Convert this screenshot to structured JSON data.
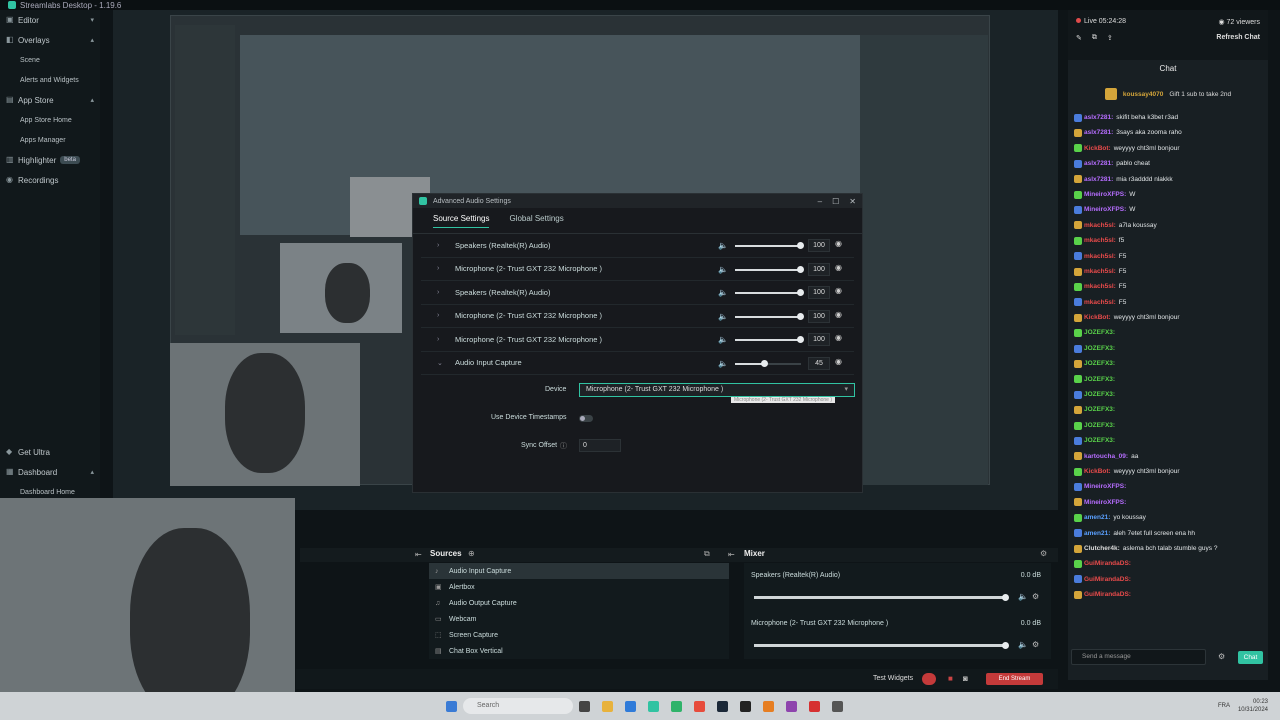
{
  "app": {
    "title": "Streamlabs Desktop - 1.19.6"
  },
  "sidebar": {
    "items": [
      {
        "label": "Editor",
        "icon": "editor-icon"
      },
      {
        "label": "Overlays",
        "icon": "overlays-icon"
      },
      {
        "label": "Scene",
        "icon": ""
      },
      {
        "label": "Alerts and Widgets",
        "icon": ""
      },
      {
        "label": "App Store",
        "icon": "app-store-icon"
      },
      {
        "label": "App Store Home",
        "icon": ""
      },
      {
        "label": "Apps Manager",
        "icon": ""
      },
      {
        "label": "Highlighter",
        "icon": "highlighter-icon",
        "badge": "beta"
      },
      {
        "label": "Recordings",
        "icon": "recordings-icon"
      }
    ],
    "bottom": {
      "get_ultra": "Get Ultra",
      "dashboard": "Dashboard",
      "dashboard_home": "Dashboard Home"
    }
  },
  "dialog": {
    "title": "Advanced Audio Settings",
    "tabs": [
      "Source Settings",
      "Global Settings"
    ],
    "rows": [
      {
        "name": "Speakers (Realtek(R) Audio)",
        "value": "100",
        "level": 1.0
      },
      {
        "name": "Microphone (2- Trust GXT 232 Microphone )",
        "value": "100",
        "level": 1.0
      },
      {
        "name": "Speakers (Realtek(R) Audio)",
        "value": "100",
        "level": 1.0
      },
      {
        "name": "Microphone (2- Trust GXT 232 Microphone )",
        "value": "100",
        "level": 1.0
      },
      {
        "name": "Microphone (2- Trust GXT 232 Microphone )",
        "value": "100",
        "level": 1.0
      },
      {
        "name": "Audio Input Capture",
        "value": "45",
        "level": 0.45
      }
    ],
    "device_label": "Device",
    "device_value": "Microphone (2- Trust GXT 232 Microphone )",
    "device_tooltip": "Microphone (2- Trust GXT 232 Microphone )",
    "timestamps_label": "Use Device Timestamps",
    "sync_label": "Sync Offset",
    "sync_value": "0"
  },
  "sources": {
    "title": "Sources",
    "items": [
      {
        "label": "Audio Input Capture",
        "icon": "audio-input-icon"
      },
      {
        "label": "Alertbox",
        "icon": "alertbox-icon"
      },
      {
        "label": "Audio Output Capture",
        "icon": "audio-output-icon"
      },
      {
        "label": "Webcam",
        "icon": "webcam-icon"
      },
      {
        "label": "Screen Capture",
        "icon": "screen-capture-icon"
      },
      {
        "label": "Chat Box Vertical",
        "icon": "chat-box-icon"
      }
    ]
  },
  "mixer": {
    "title": "Mixer",
    "channels": [
      {
        "name": "Speakers (Realtek(R) Audio)",
        "db": "0.0 dB",
        "level": 1.0
      },
      {
        "name": "Microphone (2- Trust GXT 232 Microphone )",
        "db": "0.0 dB",
        "level": 1.0
      }
    ]
  },
  "bottom_bar": {
    "test_widgets": "Test Widgets",
    "end_stream": "End Stream"
  },
  "chat": {
    "live_time": "Live 05:24:28",
    "viewers": "72 viewers",
    "refresh": "Refresh Chat",
    "title": "Chat",
    "gift_user": "koussay4070",
    "gift_text": "Gift 1 sub to take 2nd",
    "messages": [
      {
        "user": "aslx7281:",
        "text": "skifit beha k3bet r3ad",
        "color": "#b66dff"
      },
      {
        "user": "aslx7281:",
        "text": "3says aka zooma raho",
        "color": "#b66dff"
      },
      {
        "user": "KickBot:",
        "text": "weyyyy cht3ml bonjour",
        "color": "#e94b4b"
      },
      {
        "user": "aslx7281:",
        "text": "pablo cheat",
        "color": "#b66dff"
      },
      {
        "user": "aslx7281:",
        "text": "mia r3adddd nlakkk",
        "color": "#b66dff"
      },
      {
        "user": "MineiroXFPS:",
        "text": "W",
        "color": "#b66dff"
      },
      {
        "user": "MineiroXFPS:",
        "text": "W",
        "color": "#b66dff"
      },
      {
        "user": "mkach5sl:",
        "text": "a7la koussay",
        "color": "#e94b4b"
      },
      {
        "user": "mkach5sl:",
        "text": "f5",
        "color": "#e94b4b"
      },
      {
        "user": "mkach5sl:",
        "text": "F5",
        "color": "#e94b4b"
      },
      {
        "user": "mkach5sl:",
        "text": "F5",
        "color": "#e94b4b"
      },
      {
        "user": "mkach5sl:",
        "text": "F5",
        "color": "#e94b4b"
      },
      {
        "user": "mkach5sl:",
        "text": "F5",
        "color": "#e94b4b"
      },
      {
        "user": "KickBot:",
        "text": "weyyyy cht3ml bonjour",
        "color": "#e94b4b"
      },
      {
        "user": "JOZEFX3:",
        "text": "",
        "color": "#59d24a"
      },
      {
        "user": "JOZEFX3:",
        "text": "",
        "color": "#59d24a"
      },
      {
        "user": "JOZEFX3:",
        "text": "",
        "color": "#59d24a"
      },
      {
        "user": "JOZEFX3:",
        "text": "",
        "color": "#59d24a"
      },
      {
        "user": "JOZEFX3:",
        "text": "",
        "color": "#59d24a"
      },
      {
        "user": "JOZEFX3:",
        "text": "",
        "color": "#59d24a"
      },
      {
        "user": "JOZEFX3:",
        "text": "",
        "color": "#59d24a"
      },
      {
        "user": "JOZEFX3:",
        "text": "",
        "color": "#59d24a"
      },
      {
        "user": "kartoucha_09:",
        "text": "aa",
        "color": "#b66dff"
      },
      {
        "user": "KickBot:",
        "text": "weyyyy cht3ml bonjour",
        "color": "#e94b4b"
      },
      {
        "user": "MineiroXFPS:",
        "text": "",
        "color": "#b66dff"
      },
      {
        "user": "MineiroXFPS:",
        "text": "",
        "color": "#b66dff"
      },
      {
        "user": "amen21:",
        "text": "yo koussay",
        "color": "#5aa0ff"
      },
      {
        "user": "amen21:",
        "text": "aleh 7etet full screen ena hh",
        "color": "#5aa0ff"
      },
      {
        "user": "Clutcher4k:",
        "text": "aslema bch talab stumble guys ?",
        "color": "#ddd"
      },
      {
        "user": "GuiMirandaDS:",
        "text": "",
        "color": "#e94b4b"
      },
      {
        "user": "GuiMirandaDS:",
        "text": "",
        "color": "#e94b4b"
      },
      {
        "user": "GuiMirandaDS:",
        "text": "",
        "color": "#e94b4b"
      }
    ],
    "input_placeholder": "Send a message",
    "send": "Chat"
  },
  "taskbar": {
    "search": "Search",
    "lang": "FRA",
    "time": "00:23",
    "date": "10/31/2024"
  }
}
